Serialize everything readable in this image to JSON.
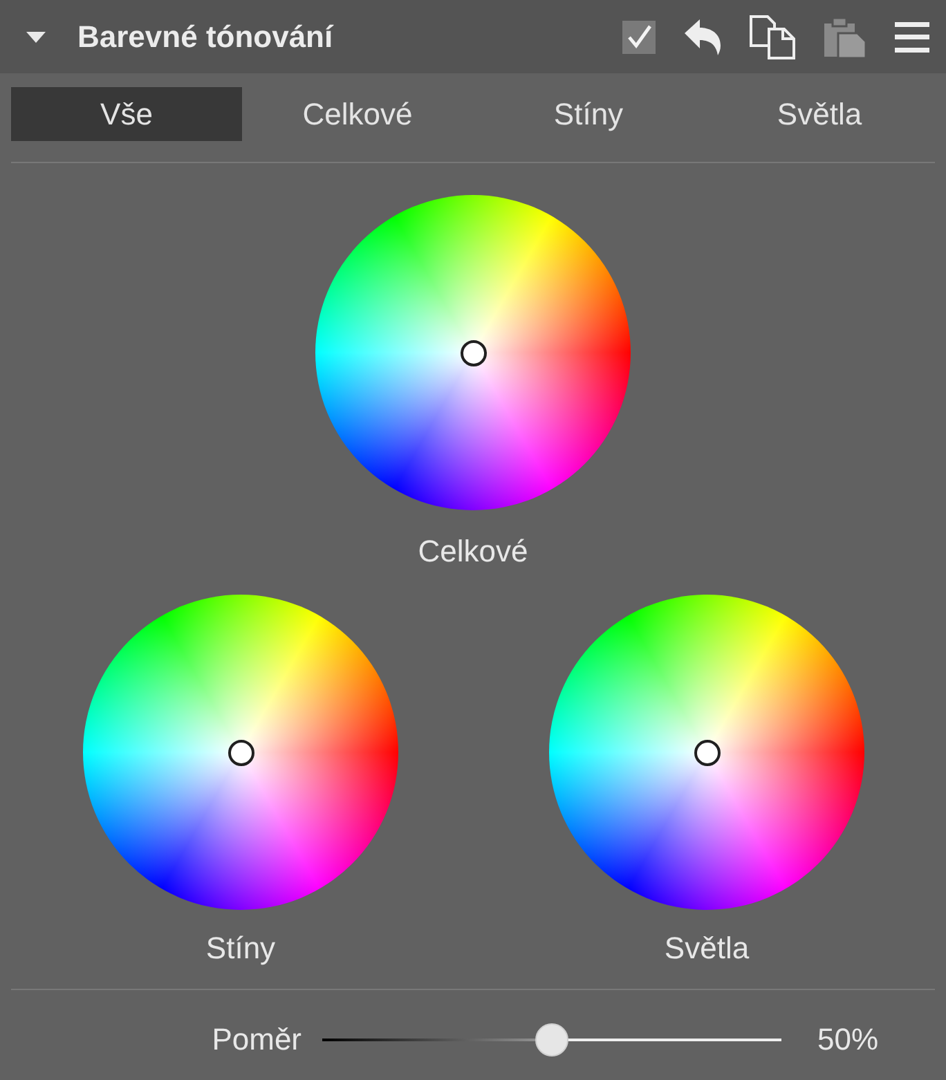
{
  "panel": {
    "title": "Barevné tónování",
    "expanded": true
  },
  "toolbar": [
    {
      "kind": "checkbox",
      "checked": true
    },
    {
      "kind": "undo"
    },
    {
      "kind": "copy"
    },
    {
      "kind": "paste",
      "disabled": true
    },
    {
      "kind": "menu"
    }
  ],
  "tabs": [
    {
      "label": "Vše",
      "selected": true
    },
    {
      "label": "Celkové",
      "selected": false
    },
    {
      "label": "Stíny",
      "selected": false
    },
    {
      "label": "Světla",
      "selected": false
    }
  ],
  "wheels": [
    {
      "label": "Celkové"
    },
    {
      "label": "Stíny"
    },
    {
      "label": "Světla"
    }
  ],
  "slider": {
    "label": "Poměr",
    "level": 0.5,
    "reading": "50%"
  }
}
